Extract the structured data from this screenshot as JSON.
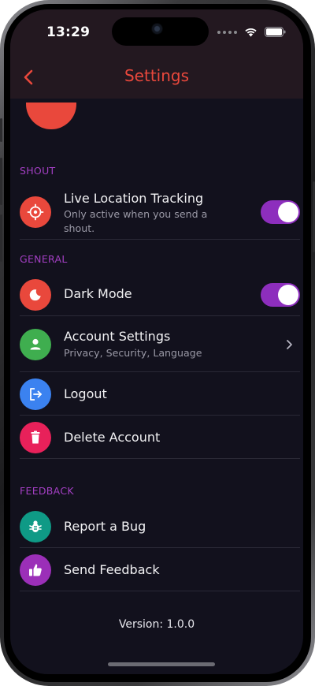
{
  "status_bar": {
    "time": "13:29"
  },
  "nav": {
    "title": "Settings"
  },
  "sections": {
    "shout": {
      "header": "SHOUT",
      "live_location": {
        "title": "Live Location Tracking",
        "subtitle": "Only active when you send a shout.",
        "enabled": true
      }
    },
    "general": {
      "header": "GENERAL",
      "dark_mode": {
        "title": "Dark Mode",
        "enabled": true
      },
      "account_settings": {
        "title": "Account Settings",
        "subtitle": "Privacy, Security, Language"
      },
      "logout": {
        "title": "Logout"
      },
      "delete_account": {
        "title": "Delete Account"
      }
    },
    "feedback": {
      "header": "FEEDBACK",
      "report_bug": {
        "title": "Report a Bug"
      },
      "send_feedback": {
        "title": "Send Feedback"
      }
    }
  },
  "footer": {
    "version": "Version: 1.0.0"
  },
  "colors": {
    "accent": "#e9483c",
    "section_header": "#a33fc3",
    "toggle_on": "#8d2ebd",
    "background": "#12111d",
    "icon_location": "#e9483c",
    "icon_dark_mode": "#e9483c",
    "icon_account": "#3fae4f",
    "icon_logout": "#3b82f0",
    "icon_delete": "#e8215a",
    "icon_bug": "#0f9a86",
    "icon_feedback": "#9b2fb8"
  },
  "icons": {
    "back": "chevron-left",
    "live_location": "crosshair",
    "dark_mode": "moon",
    "account_settings": "person",
    "logout": "logout-arrow",
    "delete_account": "trash",
    "report_bug": "bug",
    "send_feedback": "thumbs-up",
    "account_chevron": "chevron-right"
  }
}
